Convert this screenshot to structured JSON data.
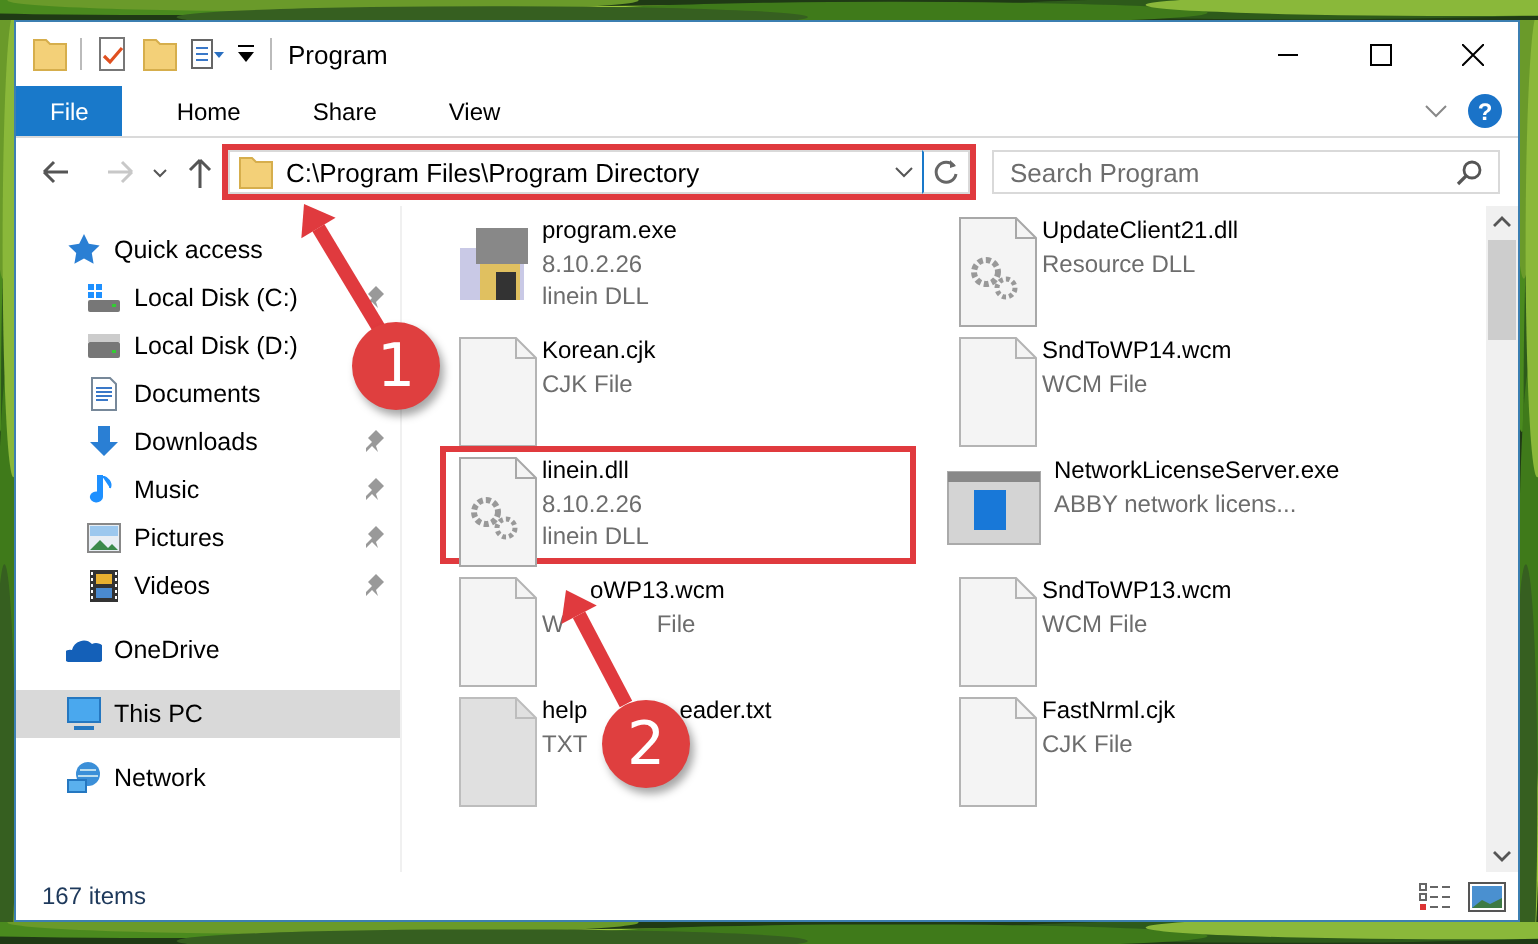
{
  "window": {
    "title": "Program"
  },
  "ribbon": {
    "tabs": [
      {
        "label": "File",
        "kind": "file"
      },
      {
        "label": "Home",
        "kind": "tab"
      },
      {
        "label": "Share",
        "kind": "tab"
      },
      {
        "label": "View",
        "kind": "tab"
      }
    ],
    "help": "?"
  },
  "address": {
    "path": "C:\\Program Files\\Program Directory",
    "highlighted": true
  },
  "search": {
    "placeholder": "Search Program"
  },
  "nav": {
    "items": [
      {
        "label": "Quick access",
        "kind": "quick",
        "selected": false,
        "pinned": false,
        "children": [
          {
            "label": "Local Disk (C:)",
            "kind": "disk-win",
            "selected": false,
            "pinned": true
          },
          {
            "label": "Local Disk (D:)",
            "kind": "disk",
            "selected": false,
            "pinned": false
          },
          {
            "label": "Documents",
            "kind": "documents",
            "selected": false,
            "pinned": false
          },
          {
            "label": "Downloads",
            "kind": "downloads",
            "selected": false,
            "pinned": true
          },
          {
            "label": "Music",
            "kind": "music",
            "selected": false,
            "pinned": true
          },
          {
            "label": "Pictures",
            "kind": "pictures",
            "selected": false,
            "pinned": true
          },
          {
            "label": "Videos",
            "kind": "videos",
            "selected": false,
            "pinned": true
          }
        ]
      },
      {
        "label": "OneDrive",
        "kind": "onedrive",
        "selected": false,
        "pinned": false
      },
      {
        "label": "This PC",
        "kind": "pc",
        "selected": true,
        "pinned": false
      },
      {
        "label": "Network",
        "kind": "network",
        "selected": false,
        "pinned": false
      }
    ]
  },
  "files": [
    {
      "name": "program.exe",
      "details": [
        "8.10.2.26",
        "linein DLL"
      ],
      "kind": "exe",
      "highlighted": false
    },
    {
      "name": "UpdateClient21.dll",
      "details": [
        "Resource DLL"
      ],
      "kind": "dll",
      "highlighted": false
    },
    {
      "name": "Korean.cjk",
      "details": [
        "CJK File"
      ],
      "kind": "page",
      "highlighted": false
    },
    {
      "name": "SndToWP14.wcm",
      "details": [
        "WCM File"
      ],
      "kind": "page",
      "highlighted": false
    },
    {
      "name": "linein.dll",
      "details": [
        "8.10.2.26",
        "linein DLL"
      ],
      "kind": "dll",
      "highlighted": true
    },
    {
      "name": "NetworkLicenseServer.exe",
      "details": [
        "ABBY network licens..."
      ],
      "kind": "app",
      "highlighted": false
    },
    {
      "name": [
        {
          "text": "oWP13.wcm",
          "gap_before": true
        }
      ],
      "details": [
        [
          {
            "text": "W",
            "gap_before": false
          },
          {
            "text": "File",
            "gap_before": true
          }
        ]
      ],
      "kind": "page",
      "highlighted": false
    },
    {
      "name": "SndToWP13.wcm",
      "details": [
        "WCM File"
      ],
      "kind": "page",
      "highlighted": false
    },
    {
      "name": [
        {
          "text": "help",
          "gap_before": false
        },
        {
          "text": "eader.txt",
          "gap_before": true
        }
      ],
      "details": [
        "TXT"
      ],
      "kind": "text",
      "highlighted": false
    },
    {
      "name": "FastNrml.cjk",
      "details": [
        "CJK File"
      ],
      "kind": "page",
      "highlighted": false
    }
  ],
  "status_bar": {
    "count": "167 items"
  },
  "annotations": [
    {
      "label": "1"
    },
    {
      "label": "2"
    }
  ]
}
